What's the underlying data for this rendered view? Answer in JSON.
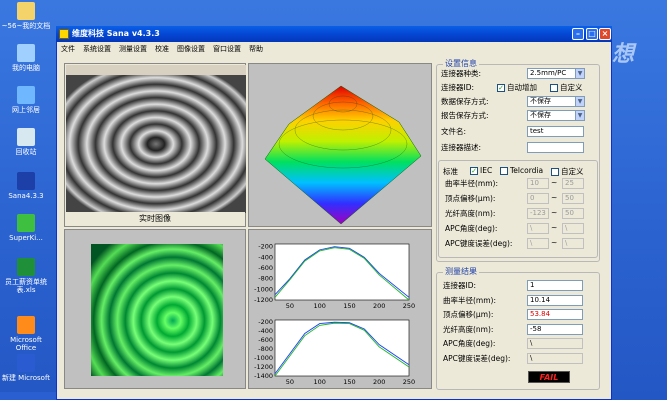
{
  "desktop": {
    "icons": [
      {
        "label": "~56~我的文档",
        "color": "#f4d36b"
      },
      {
        "label": "我的电脑",
        "color": "#9fd0ff"
      },
      {
        "label": "网上邻居",
        "color": "#6fb8ff"
      },
      {
        "label": "回收站",
        "color": "#d8e8f0"
      },
      {
        "label": "Sana4.3.3",
        "color": "#1d3fa8"
      },
      {
        "label": "SuperKi...",
        "color": "#3fbf3f"
      },
      {
        "label": "员工薪资单统表.xls",
        "color": "#1f8f3a"
      },
      {
        "label": "Microsoft Office",
        "color": "#ff8c1a"
      },
      {
        "label": "新建 Microsoft",
        "color": "#2b5bd0"
      }
    ],
    "decoration_text": "想"
  },
  "window": {
    "title": "维度科技 Sana v4.3.3"
  },
  "menu": [
    "文件",
    "系统设置",
    "测量设置",
    "校准",
    "图像设置",
    "窗口设置",
    "帮助"
  ],
  "panels": {
    "live_caption": "实时图像"
  },
  "settings": {
    "title": "设置信息",
    "rows": [
      {
        "label": "连接器种类:",
        "value": "2.5mm/PC"
      },
      {
        "label": "连接器ID:",
        "auto": "自动增加",
        "custom": "自定义"
      },
      {
        "label": "数据保存方式:",
        "value": "不保存"
      },
      {
        "label": "报告保存方式:",
        "value": "不保存"
      },
      {
        "label": "文件名:",
        "value": "test"
      },
      {
        "label": "连接器描述:",
        "value": ""
      }
    ],
    "standard": {
      "label": "标准",
      "iec": "IEC",
      "telcordia": "Telcordia",
      "custom": "自定义"
    },
    "ranges": [
      {
        "label": "曲率半径(mm):",
        "min": "10",
        "max": "25"
      },
      {
        "label": "顶点偏移(µm):",
        "min": "0",
        "max": "50"
      },
      {
        "label": "光纤高度(nm):",
        "min": "-123",
        "max": "50"
      },
      {
        "label": "APC角度(deg):",
        "min": "\\",
        "max": "\\"
      },
      {
        "label": "APC键度误差(deg):",
        "min": "\\",
        "max": "\\"
      }
    ],
    "tilde": "~"
  },
  "results": {
    "title": "测量结果",
    "rows": [
      {
        "label": "连接器ID:",
        "value": "1",
        "color": "#000000"
      },
      {
        "label": "曲率半径(mm):",
        "value": "10.14",
        "color": "#000000"
      },
      {
        "label": "顶点偏移(µm):",
        "value": "53.84",
        "color": "#e00000"
      },
      {
        "label": "光纤高度(nm):",
        "value": "-58",
        "color": "#000000"
      },
      {
        "label": "APC角度(deg):",
        "value": "\\",
        "color": "#000000"
      },
      {
        "label": "APC键度误差(deg):",
        "value": "\\",
        "color": "#000000"
      }
    ],
    "status": "FAIL"
  },
  "chart_data": [
    {
      "type": "line",
      "series": [
        {
          "values": [
            -1100,
            -800,
            -450,
            -260,
            -200,
            -230,
            -400,
            -700,
            -1150
          ]
        },
        {
          "values": [
            -1150,
            -820,
            -470,
            -280,
            -220,
            -250,
            -420,
            -730,
            -1200
          ]
        }
      ],
      "x": [
        25,
        50,
        75,
        100,
        125,
        150,
        175,
        200,
        250
      ],
      "yticks": [
        -200,
        -400,
        -600,
        -800,
        -1000,
        -1200
      ],
      "xticks": [
        50,
        100,
        150,
        200,
        250
      ],
      "xlim": [
        25,
        250
      ],
      "ylim": [
        -1200,
        -150
      ]
    },
    {
      "type": "line",
      "series": [
        {
          "values": [
            -1350,
            -900,
            -450,
            -230,
            -200,
            -210,
            -350,
            -700,
            -1150
          ]
        },
        {
          "values": [
            -1400,
            -950,
            -500,
            -270,
            -220,
            -230,
            -380,
            -750,
            -1200
          ]
        }
      ],
      "x": [
        25,
        50,
        75,
        100,
        125,
        150,
        175,
        200,
        250
      ],
      "yticks": [
        -200,
        -400,
        -600,
        -800,
        -1000,
        -1200,
        -1400
      ],
      "xticks": [
        50,
        100,
        150,
        200,
        250
      ],
      "xlim": [
        25,
        250
      ],
      "ylim": [
        -1400,
        -150
      ]
    }
  ]
}
